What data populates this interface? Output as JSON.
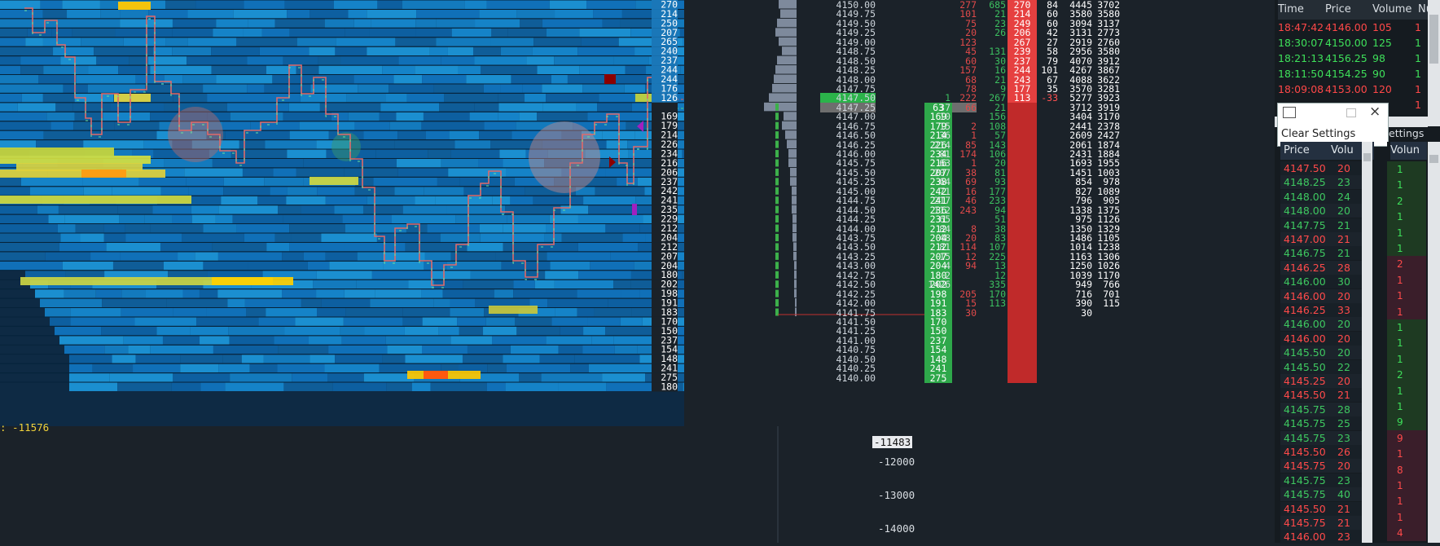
{
  "heatmap": {
    "levels": [
      "270",
      "214",
      "250",
      "207",
      "265",
      "240",
      "237",
      "244",
      "244",
      "176",
      "126",
      "",
      "169",
      "179",
      "214",
      "226",
      "234",
      "216",
      "206",
      "237",
      "242",
      "241",
      "235",
      "229",
      "212",
      "204",
      "212",
      "207",
      "204",
      "180",
      "202",
      "198",
      "191",
      "183",
      "170",
      "150",
      "237",
      "154",
      "148",
      "241",
      "275",
      "180"
    ]
  },
  "cvd": {
    "label": ": -11576",
    "last_value": "-11483",
    "axis_ticks": [
      "-12000",
      "-13000",
      "-14000"
    ]
  },
  "ladder": {
    "rows": [
      {
        "price": "4150.00",
        "bid": "",
        "bidvol": "",
        "ask": "277",
        "askvol": "685",
        "sell": "270",
        "s2": "84",
        "c1": "4445",
        "c2": "3702"
      },
      {
        "price": "4149.75",
        "bid": "",
        "bidvol": "",
        "ask": "101",
        "askvol": "21",
        "sell": "214",
        "s2": "60",
        "c1": "3580",
        "c2": "3580"
      },
      {
        "price": "4149.50",
        "bid": "",
        "bidvol": "",
        "ask": "75",
        "askvol": "23",
        "sell": "249",
        "s2": "60",
        "c1": "3094",
        "c2": "3137"
      },
      {
        "price": "4149.25",
        "bid": "",
        "bidvol": "",
        "ask": "20",
        "askvol": "26",
        "sell": "206",
        "s2": "42",
        "c1": "3131",
        "c2": "2773"
      },
      {
        "price": "4149.00",
        "bid": "",
        "bidvol": "",
        "ask": "123",
        "askvol": "",
        "sell": "267",
        "s2": "27",
        "c1": "2919",
        "c2": "2760"
      },
      {
        "price": "4148.75",
        "bid": "",
        "bidvol": "",
        "ask": "45",
        "askvol": "131",
        "sell": "239",
        "s2": "58",
        "c1": "2956",
        "c2": "3580"
      },
      {
        "price": "4148.50",
        "bid": "",
        "bidvol": "",
        "ask": "60",
        "askvol": "30",
        "sell": "237",
        "s2": "79",
        "c1": "4070",
        "c2": "3912"
      },
      {
        "price": "4148.25",
        "bid": "",
        "bidvol": "",
        "ask": "157",
        "askvol": "16",
        "sell": "244",
        "s2": "101",
        "c1": "4267",
        "c2": "3867"
      },
      {
        "price": "4148.00",
        "bid": "",
        "bidvol": "",
        "ask": "68",
        "askvol": "21",
        "sell": "243",
        "s2": "67",
        "c1": "4088",
        "c2": "3622"
      },
      {
        "price": "4147.75",
        "bid": "",
        "bidvol": "",
        "ask": "78",
        "askvol": "9",
        "sell": "177",
        "s2": "35",
        "c1": "3570",
        "c2": "3281"
      },
      {
        "price": "4147.50",
        "bid": "1",
        "bidvol": "",
        "ask": "222",
        "askvol": "267",
        "sell": "113",
        "s2": "-33",
        "c1": "5277",
        "c2": "3923"
      },
      {
        "price": "4147.25",
        "bid": "37",
        "bidvol": "63",
        "ask": "66",
        "askvol": "21",
        "sell": "",
        "s2": "",
        "c1": "3712",
        "c2": "3919"
      },
      {
        "price": "4147.00",
        "bid": "10",
        "bidvol": "169",
        "ask": "",
        "askvol": "156",
        "sell": "",
        "s2": "",
        "c1": "3404",
        "c2": "3170"
      },
      {
        "price": "4146.75",
        "bid": "15",
        "bidvol": "179",
        "ask": "2",
        "askvol": "108",
        "sell": "",
        "s2": "",
        "c1": "2441",
        "c2": "2378"
      },
      {
        "price": "4146.50",
        "bid": "36",
        "bidvol": "214",
        "ask": "1",
        "askvol": "57",
        "sell": "",
        "s2": "",
        "c1": "2609",
        "c2": "2427"
      },
      {
        "price": "4146.25",
        "bid": "214",
        "bidvol": "226",
        "ask": "85",
        "askvol": "143",
        "sell": "",
        "s2": "",
        "c1": "2061",
        "c2": "1874"
      },
      {
        "price": "4146.00",
        "bid": "81",
        "bidvol": "234",
        "ask": "174",
        "askvol": "106",
        "sell": "",
        "s2": "",
        "c1": "2431",
        "c2": "1884"
      },
      {
        "price": "4145.75",
        "bid": "63",
        "bidvol": "216",
        "ask": "1",
        "askvol": "20",
        "sell": "",
        "s2": "",
        "c1": "1693",
        "c2": "1955"
      },
      {
        "price": "4145.50",
        "bid": "207",
        "bidvol": "207",
        "ask": "38",
        "askvol": "81",
        "sell": "",
        "s2": "",
        "c1": "1451",
        "c2": "1003"
      },
      {
        "price": "4145.25",
        "bid": "64",
        "bidvol": "238",
        "ask": "69",
        "askvol": "93",
        "sell": "",
        "s2": "",
        "c1": "854",
        "c2": "978"
      },
      {
        "price": "4145.00",
        "bid": "71",
        "bidvol": "242",
        "ask": "16",
        "askvol": "177",
        "sell": "",
        "s2": "",
        "c1": "827",
        "c2": "1089"
      },
      {
        "price": "4144.75",
        "bid": "217",
        "bidvol": "241",
        "ask": "46",
        "askvol": "233",
        "sell": "",
        "s2": "",
        "c1": "796",
        "c2": "905"
      },
      {
        "price": "4144.50",
        "bid": "112",
        "bidvol": "236",
        "ask": "243",
        "askvol": "94",
        "sell": "",
        "s2": "",
        "c1": "1338",
        "c2": "1375"
      },
      {
        "price": "4144.25",
        "bid": "65",
        "bidvol": "231",
        "ask": "",
        "askvol": "51",
        "sell": "",
        "s2": "",
        "c1": "975",
        "c2": "1126"
      },
      {
        "price": "4144.00",
        "bid": "84",
        "bidvol": "212",
        "ask": "8",
        "askvol": "38",
        "sell": "",
        "s2": "",
        "c1": "1350",
        "c2": "1329"
      },
      {
        "price": "4143.75",
        "bid": "48",
        "bidvol": "204",
        "ask": "20",
        "askvol": "83",
        "sell": "",
        "s2": "",
        "c1": "1486",
        "c2": "1105"
      },
      {
        "price": "4143.50",
        "bid": "81",
        "bidvol": "212",
        "ask": "114",
        "askvol": "107",
        "sell": "",
        "s2": "",
        "c1": "1014",
        "c2": "1238"
      },
      {
        "price": "4143.25",
        "bid": "15",
        "bidvol": "207",
        "ask": "12",
        "askvol": "225",
        "sell": "",
        "s2": "",
        "c1": "1163",
        "c2": "1306"
      },
      {
        "price": "4143.00",
        "bid": "4",
        "bidvol": "204",
        "ask": "94",
        "askvol": "13",
        "sell": "",
        "s2": "",
        "c1": "1250",
        "c2": "1026"
      },
      {
        "price": "4142.75",
        "bid": "2",
        "bidvol": "180",
        "ask": "",
        "askvol": "12",
        "sell": "",
        "s2": "",
        "c1": "1039",
        "c2": "1170"
      },
      {
        "price": "4142.50",
        "bid": "1426",
        "bidvol": "202",
        "ask": "",
        "askvol": "335",
        "sell": "",
        "s2": "",
        "c1": "949",
        "c2": "766"
      },
      {
        "price": "4142.25",
        "bid": "",
        "bidvol": "198",
        "ask": "205",
        "askvol": "170",
        "sell": "",
        "s2": "",
        "c1": "716",
        "c2": "701"
      },
      {
        "price": "4142.00",
        "bid": "",
        "bidvol": "191",
        "ask": "15",
        "askvol": "113",
        "sell": "",
        "s2": "",
        "c1": "390",
        "c2": "115"
      },
      {
        "price": "4141.75",
        "bid": "",
        "bidvol": "183",
        "ask": "30",
        "askvol": "",
        "sell": "",
        "s2": "",
        "c1": "30",
        "c2": ""
      },
      {
        "price": "4141.50",
        "bid": "",
        "bidvol": "170",
        "ask": "",
        "askvol": "",
        "sell": "",
        "s2": "",
        "c1": "",
        "c2": ""
      },
      {
        "price": "4141.25",
        "bid": "",
        "bidvol": "150",
        "ask": "",
        "askvol": "",
        "sell": "",
        "s2": "",
        "c1": "",
        "c2": ""
      },
      {
        "price": "4141.00",
        "bid": "",
        "bidvol": "237",
        "ask": "",
        "askvol": "",
        "sell": "",
        "s2": "",
        "c1": "",
        "c2": ""
      },
      {
        "price": "4140.75",
        "bid": "",
        "bidvol": "154",
        "ask": "",
        "askvol": "",
        "sell": "",
        "s2": "",
        "c1": "",
        "c2": ""
      },
      {
        "price": "4140.50",
        "bid": "",
        "bidvol": "148",
        "ask": "",
        "askvol": "",
        "sell": "",
        "s2": "",
        "c1": "",
        "c2": ""
      },
      {
        "price": "4140.25",
        "bid": "",
        "bidvol": "241",
        "ask": "",
        "askvol": "",
        "sell": "",
        "s2": "",
        "c1": "",
        "c2": ""
      },
      {
        "price": "4140.00",
        "bid": "",
        "bidvol": "275",
        "ask": "",
        "askvol": "",
        "sell": "",
        "s2": "",
        "c1": "",
        "c2": ""
      }
    ]
  },
  "time_sales": {
    "headers": [
      "Time",
      "Price",
      "Volume",
      "Nu"
    ],
    "rows": [
      {
        "time": "18:47:42",
        "price": "4146.00",
        "volume": "105",
        "n": "1",
        "side": "sell"
      },
      {
        "time": "18:30:07",
        "price": "4150.00",
        "volume": "125",
        "n": "1",
        "side": "buy"
      },
      {
        "time": "18:21:13",
        "price": "4156.25",
        "volume": "98",
        "n": "1",
        "side": "buy"
      },
      {
        "time": "18:11:50",
        "price": "4154.25",
        "volume": "90",
        "n": "1",
        "side": "buy"
      },
      {
        "time": "18:09:08",
        "price": "4153.00",
        "volume": "120",
        "n": "1",
        "side": "sell"
      },
      {
        "time": "",
        "price": "",
        "volume": "",
        "n": "1",
        "side": "sell"
      }
    ]
  },
  "mini_window": {
    "clear": "Clear",
    "settings": "Settings"
  },
  "settings_partial": "ettings",
  "price_tape": {
    "headers": [
      "Price",
      "Volu"
    ],
    "rows": [
      {
        "price": "4147.50",
        "vol": "20",
        "side": "sell"
      },
      {
        "price": "4148.25",
        "vol": "23",
        "side": "buy"
      },
      {
        "price": "4148.00",
        "vol": "24",
        "side": "buy"
      },
      {
        "price": "4148.00",
        "vol": "20",
        "side": "buy"
      },
      {
        "price": "4147.75",
        "vol": "21",
        "side": "buy"
      },
      {
        "price": "4147.00",
        "vol": "21",
        "side": "sell"
      },
      {
        "price": "4146.75",
        "vol": "21",
        "side": "buy"
      },
      {
        "price": "4146.25",
        "vol": "28",
        "side": "sell"
      },
      {
        "price": "4146.00",
        "vol": "30",
        "side": "buy"
      },
      {
        "price": "4146.00",
        "vol": "20",
        "side": "sell"
      },
      {
        "price": "4146.25",
        "vol": "33",
        "side": "sell"
      },
      {
        "price": "4146.00",
        "vol": "20",
        "side": "buy"
      },
      {
        "price": "4146.00",
        "vol": "20",
        "side": "sell"
      },
      {
        "price": "4145.50",
        "vol": "20",
        "side": "buy"
      },
      {
        "price": "4145.50",
        "vol": "22",
        "side": "buy"
      },
      {
        "price": "4145.25",
        "vol": "20",
        "side": "sell"
      },
      {
        "price": "4145.50",
        "vol": "21",
        "side": "sell"
      },
      {
        "price": "4145.75",
        "vol": "28",
        "side": "buy"
      },
      {
        "price": "4145.75",
        "vol": "25",
        "side": "buy"
      },
      {
        "price": "4145.75",
        "vol": "23",
        "side": "buy"
      },
      {
        "price": "4145.50",
        "vol": "26",
        "side": "sell"
      },
      {
        "price": "4145.75",
        "vol": "20",
        "side": "sell"
      },
      {
        "price": "4145.75",
        "vol": "23",
        "side": "buy"
      },
      {
        "price": "4145.75",
        "vol": "40",
        "side": "buy"
      },
      {
        "price": "4145.50",
        "vol": "21",
        "side": "sell"
      },
      {
        "price": "4145.75",
        "vol": "21",
        "side": "sell"
      },
      {
        "price": "4146.00",
        "vol": "23",
        "side": "sell"
      }
    ]
  },
  "vol_strip": {
    "header": "Volun",
    "rows": [
      {
        "v": "1",
        "side": "buy"
      },
      {
        "v": "1",
        "side": "buy"
      },
      {
        "v": "2",
        "side": "buy"
      },
      {
        "v": "1",
        "side": "buy"
      },
      {
        "v": "1",
        "side": "buy"
      },
      {
        "v": "1",
        "side": "buy"
      },
      {
        "v": "2",
        "side": "sell"
      },
      {
        "v": "1",
        "side": "sell"
      },
      {
        "v": "1",
        "side": "sell"
      },
      {
        "v": "1",
        "side": "sell"
      },
      {
        "v": "1",
        "side": "buy"
      },
      {
        "v": "1",
        "side": "buy"
      },
      {
        "v": "1",
        "side": "buy"
      },
      {
        "v": "2",
        "side": "buy"
      },
      {
        "v": "1",
        "side": "buy"
      },
      {
        "v": "1",
        "side": "buy"
      },
      {
        "v": "9",
        "side": "buy"
      },
      {
        "v": "9",
        "side": "sell"
      },
      {
        "v": "1",
        "side": "sell"
      },
      {
        "v": "8",
        "side": "sell"
      },
      {
        "v": "1",
        "side": "sell"
      },
      {
        "v": "1",
        "side": "sell"
      },
      {
        "v": "1",
        "side": "sell"
      },
      {
        "v": "4",
        "side": "sell"
      }
    ]
  },
  "colors": {
    "buy": "#3cb04a",
    "sell": "#e14646",
    "bg": "#1b2229",
    "cvd": "#f0d23a"
  }
}
